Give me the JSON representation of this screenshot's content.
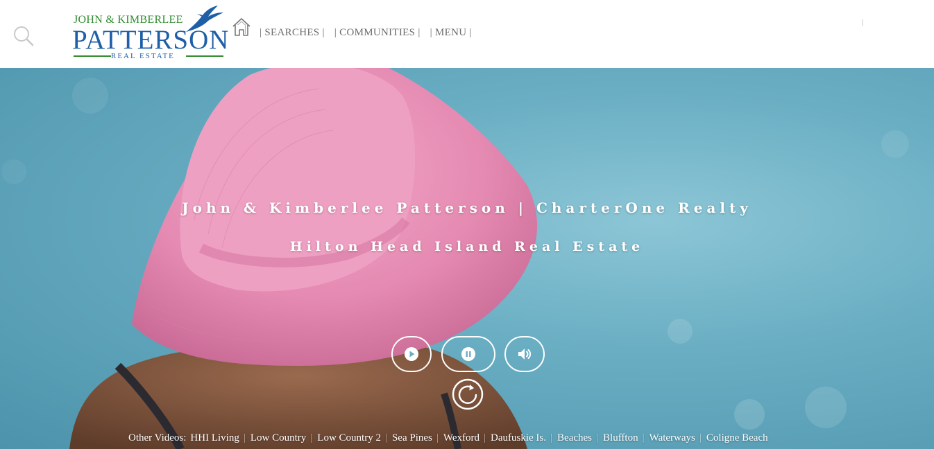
{
  "logo": {
    "line1": "JOHN & KIMBERLEE",
    "line2": "PATTERSON",
    "line3": "REAL ESTATE"
  },
  "nav": {
    "items": [
      "| SEARCHES |",
      "| COMMUNITIES |",
      "| MENU |"
    ]
  },
  "header_right_sep": "|",
  "hero": {
    "headline": "John & Kimberlee Patterson | CharterOne Realty",
    "subheadline": "Hilton Head Island Real Estate"
  },
  "videos": {
    "label": "Other Videos:",
    "links": [
      "HHI Living",
      "Low Country",
      "Low Country 2",
      "Sea Pines",
      "Wexford",
      "Daufuskie Is.",
      "Beaches",
      "Bluffton",
      "Waterways",
      "Coligne Beach"
    ]
  },
  "colors": {
    "logo_green": "#2e8b2e",
    "logo_blue": "#1f5fa8",
    "hat_pink": "#e98fb6",
    "sky_blue": "#6aaec3"
  },
  "icons": {
    "search": "search-icon",
    "home": "home-icon",
    "play": "play-icon",
    "pause": "pause-icon",
    "volume": "volume-icon",
    "replay": "replay-icon"
  }
}
